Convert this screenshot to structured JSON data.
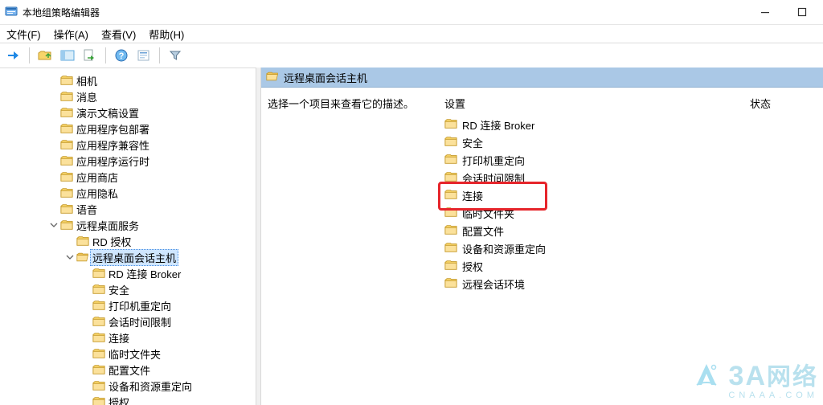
{
  "window": {
    "title": "本地组策略编辑器"
  },
  "menu": {
    "file": "文件(F)",
    "action": "操作(A)",
    "view": "查看(V)",
    "help": "帮助(H)"
  },
  "tree": {
    "items": [
      {
        "indent": 3,
        "twisty": "",
        "label": "相机"
      },
      {
        "indent": 3,
        "twisty": "",
        "label": "消息"
      },
      {
        "indent": 3,
        "twisty": "",
        "label": "演示文稿设置"
      },
      {
        "indent": 3,
        "twisty": "",
        "label": "应用程序包部署"
      },
      {
        "indent": 3,
        "twisty": "",
        "label": "应用程序兼容性"
      },
      {
        "indent": 3,
        "twisty": "",
        "label": "应用程序运行时"
      },
      {
        "indent": 3,
        "twisty": "",
        "label": "应用商店"
      },
      {
        "indent": 3,
        "twisty": "",
        "label": "应用隐私"
      },
      {
        "indent": 3,
        "twisty": "",
        "label": "语音"
      },
      {
        "indent": 3,
        "twisty": "open",
        "label": "远程桌面服务"
      },
      {
        "indent": 4,
        "twisty": "",
        "label": "RD 授权"
      },
      {
        "indent": 4,
        "twisty": "open",
        "label": "远程桌面会话主机",
        "selected": true,
        "openIcon": true
      },
      {
        "indent": 5,
        "twisty": "",
        "label": "RD 连接 Broker"
      },
      {
        "indent": 5,
        "twisty": "",
        "label": "安全"
      },
      {
        "indent": 5,
        "twisty": "",
        "label": "打印机重定向"
      },
      {
        "indent": 5,
        "twisty": "",
        "label": "会话时间限制"
      },
      {
        "indent": 5,
        "twisty": "",
        "label": "连接"
      },
      {
        "indent": 5,
        "twisty": "",
        "label": "临时文件夹"
      },
      {
        "indent": 5,
        "twisty": "",
        "label": "配置文件"
      },
      {
        "indent": 5,
        "twisty": "",
        "label": "设备和资源重定向"
      },
      {
        "indent": 5,
        "twisty": "",
        "label": "授权"
      }
    ]
  },
  "details": {
    "header": "远程桌面会话主机",
    "desc": "选择一个项目来查看它的描述。",
    "col_settings": "设置",
    "col_state": "状态",
    "items": [
      {
        "label": "RD 连接 Broker"
      },
      {
        "label": "安全"
      },
      {
        "label": "打印机重定向"
      },
      {
        "label": "会话时间限制"
      },
      {
        "label": "连接",
        "highlight": true
      },
      {
        "label": "临时文件夹"
      },
      {
        "label": "配置文件"
      },
      {
        "label": "设备和资源重定向"
      },
      {
        "label": "授权"
      },
      {
        "label": "远程会话环境"
      }
    ]
  },
  "watermark": {
    "brand_main": "3A",
    "brand_cn": "网络",
    "brand_sub": "CNAAA.COM"
  }
}
